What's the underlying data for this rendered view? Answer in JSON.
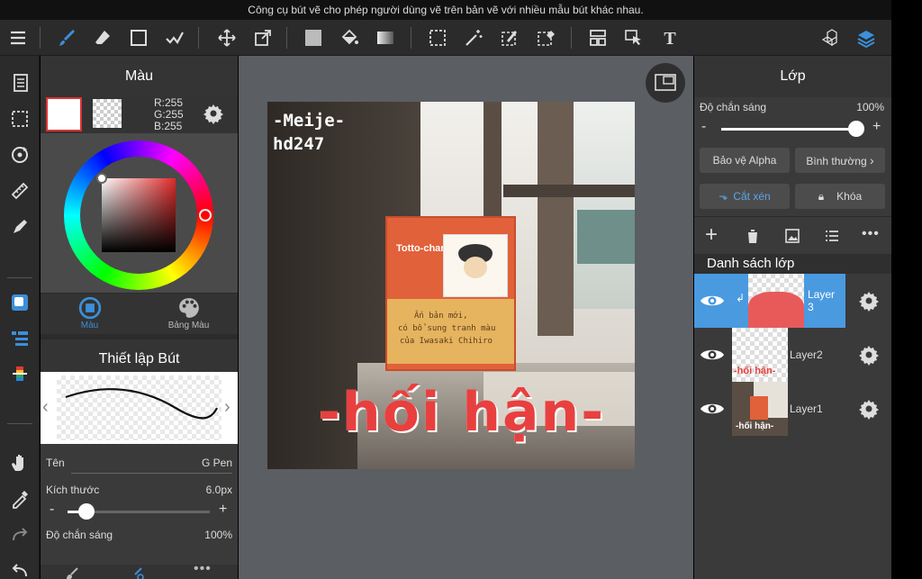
{
  "tooltip": "Công cụ bút vẽ cho phép người dùng vẽ trên bản vẽ với nhiều mẫu bút khác nhau.",
  "color_panel": {
    "title": "Màu",
    "rgb": {
      "r": "R:255",
      "g": "G:255",
      "b": "B:255"
    },
    "tabs": [
      {
        "label": "Màu"
      },
      {
        "label": "Bảng Màu"
      }
    ]
  },
  "brush_panel": {
    "title": "Thiết lập Bút",
    "name_label": "Tên",
    "name_value": "G Pen",
    "size_label": "Kích thước",
    "size_value": "6.0px",
    "size_level": 0.08,
    "opacity_label": "Độ chắn sáng",
    "opacity_value": "100%"
  },
  "artwork": {
    "signature_line1": "-Meije-",
    "signature_line2": "hd247",
    "book_title": "Totto-chan",
    "book_line1": "Ấn bản mới,",
    "book_line2": "có bổ sung tranh màu",
    "book_line3": "của Iwasaki Chihiro",
    "lettering": "-hối hận-"
  },
  "layer_panel": {
    "title": "Lớp",
    "opacity_label": "Độ chắn sáng",
    "opacity_value": "100%",
    "opacity_level": 1.0,
    "alpha_protect": "Bảo vệ Alpha",
    "blend_mode": "Bình thường",
    "clipping": "Cắt xén",
    "lock": "Khóa",
    "list_title": "Danh sách lớp",
    "layers": [
      {
        "name": "Layer\n3",
        "selected": true
      },
      {
        "name": "Layer2",
        "selected": false
      },
      {
        "name": "Layer1",
        "selected": false
      }
    ]
  },
  "colors": {
    "accent": "#3c8fd9",
    "selected_layer": "#4a9ae0",
    "panel": "#3a3a3a",
    "toolbar": "#2b2b2b",
    "canvas_bg": "#5b5e63",
    "lettering": "#e8403f"
  },
  "icons": {
    "toolbar": [
      "menu-icon",
      "brush-icon",
      "eraser-icon",
      "rectangle-icon",
      "smudge-icon",
      "move-icon",
      "transform-icon",
      "fill-color-icon",
      "bucket-icon",
      "gradient-icon",
      "select-rect-icon",
      "magic-wand-icon",
      "select-pen-icon",
      "select-eraser-icon",
      "layout-icon",
      "select-arrow-icon",
      "text-icon",
      "3d-icon",
      "layers-icon"
    ],
    "sidebar": [
      "pages-icon",
      "selection-icon",
      "rotate-icon",
      "ruler-icon",
      "pen-color-icon",
      "color-swatch-icon",
      "layer-list-icon",
      "palette-bar-icon",
      "hand-icon",
      "eyedropper-icon",
      "redo-icon",
      "undo-icon"
    ]
  }
}
